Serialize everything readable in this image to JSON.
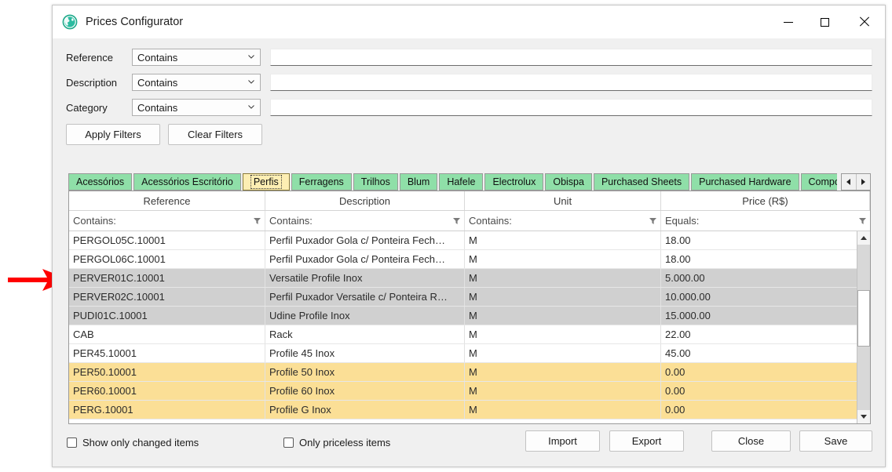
{
  "window": {
    "title": "Prices Configurator",
    "icon": "globe-icon",
    "minimize_label": "Minimize",
    "maximize_label": "Maximize",
    "close_label": "Close"
  },
  "filters": {
    "rows": [
      {
        "label": "Reference",
        "operator": "Contains",
        "value": "",
        "placeholder": ""
      },
      {
        "label": "Description",
        "operator": "Contains",
        "value": "",
        "placeholder": ""
      },
      {
        "label": "Category",
        "operator": "Contains",
        "value": "",
        "placeholder": ""
      }
    ],
    "apply_label": "Apply Filters",
    "clear_label": "Clear Filters"
  },
  "tabs": {
    "selected": "Perfis",
    "items": [
      {
        "label": "Acessórios"
      },
      {
        "label": "Acessórios Escritório"
      },
      {
        "label": "Perfis"
      },
      {
        "label": "Ferragens"
      },
      {
        "label": "Trilhos"
      },
      {
        "label": "Blum"
      },
      {
        "label": "Hafele"
      },
      {
        "label": "Electrolux"
      },
      {
        "label": "Obispa"
      },
      {
        "label": "Purchased Sheets"
      },
      {
        "label": "Purchased Hardware"
      },
      {
        "label": "Componentes"
      }
    ],
    "scroll_left": "scroll-tabs-left",
    "scroll_right": "scroll-tabs-right"
  },
  "grid": {
    "columns": [
      {
        "header": "Reference",
        "filter": "Contains:"
      },
      {
        "header": "Description",
        "filter": "Contains:"
      },
      {
        "header": "Unit",
        "filter": "Contains:"
      },
      {
        "header": "Price (R$)",
        "filter": "Equals:"
      }
    ],
    "rows": [
      {
        "reference": "PERGOL05C.10001",
        "description": "Perfil Puxador Gola c/ Ponteira Fech…",
        "unit": "M",
        "price": "18.00",
        "state": "normal"
      },
      {
        "reference": "PERGOL06C.10001",
        "description": "Perfil Puxador Gola c/ Ponteira Fech…",
        "unit": "M",
        "price": "18.00",
        "state": "normal"
      },
      {
        "reference": "PERVER01C.10001",
        "description": "Versatile Profile Inox",
        "unit": "M",
        "price": "5.000.00",
        "state": "selected"
      },
      {
        "reference": "PERVER02C.10001",
        "description": "Perfil Puxador Versatile c/ Ponteira R…",
        "unit": "M",
        "price": "10.000.00",
        "state": "selected"
      },
      {
        "reference": "PUDI01C.10001",
        "description": "Udine Profile Inox",
        "unit": "M",
        "price": "15.000.00",
        "state": "selected"
      },
      {
        "reference": "CAB",
        "description": "Rack",
        "unit": "M",
        "price": "22.00",
        "state": "normal"
      },
      {
        "reference": "PER45.10001",
        "description": "Profile 45 Inox",
        "unit": "M",
        "price": "45.00",
        "state": "normal"
      },
      {
        "reference": "PER50.10001",
        "description": "Profile 50 Inox",
        "unit": "M",
        "price": "0.00",
        "state": "highlight"
      },
      {
        "reference": "PER60.10001",
        "description": "Profile 60 Inox",
        "unit": "M",
        "price": "0.00",
        "state": "highlight"
      },
      {
        "reference": "PERG.10001",
        "description": "Profile G Inox",
        "unit": "M",
        "price": "0.00",
        "state": "highlight"
      }
    ],
    "scroll_up": "scroll-up",
    "scroll_down": "scroll-down"
  },
  "footer": {
    "checkbox_changed": {
      "label": "Show only changed items",
      "checked": false
    },
    "checkbox_priceless": {
      "label": "Only priceless items",
      "checked": false
    },
    "import_label": "Import",
    "export_label": "Export",
    "close_label": "Close",
    "save_label": "Save"
  },
  "annotation": {
    "arrow": "red-arrow-pointing-to-row",
    "color": "#ff0000",
    "target_row": "PERVER01C.10001"
  },
  "colors": {
    "tab": "#8fdfa8",
    "tab_selected": "#fdeeb3",
    "row_selected": "#d0d0d0",
    "row_highlight": "#fbdf96",
    "window_bg": "#f0f0f0"
  }
}
